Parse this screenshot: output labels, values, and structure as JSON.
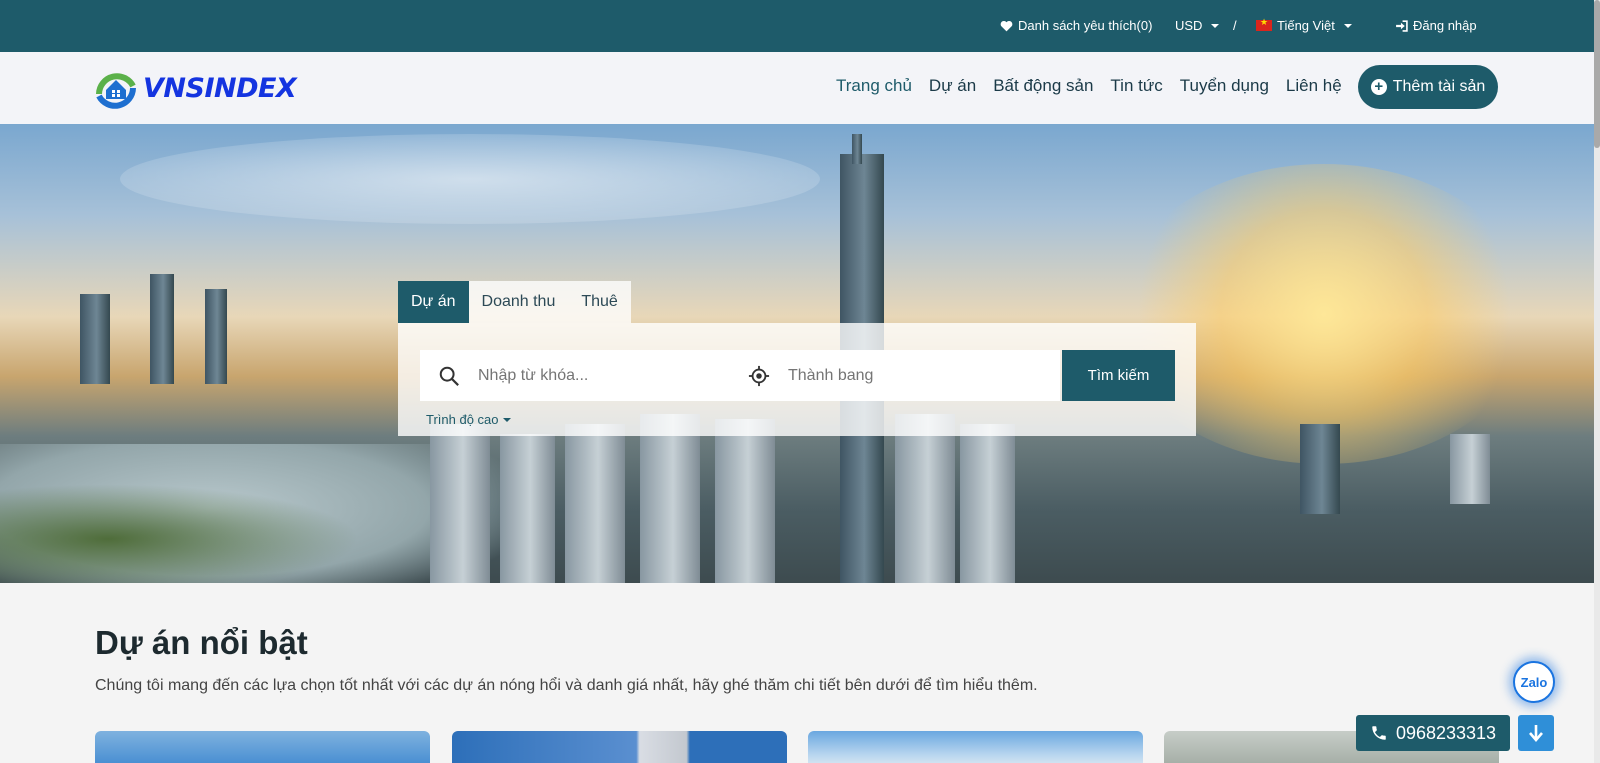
{
  "topbar": {
    "wishlist": "Danh sách yêu thích(0)",
    "currency": "USD",
    "separator": "/",
    "language": "Tiếng Việt",
    "login": "Đăng nhập"
  },
  "header": {
    "logo_text": "VNSINDEX",
    "nav": [
      "Trang chủ",
      "Dự án",
      "Bất động sản",
      "Tin tức",
      "Tuyển dụng",
      "Liên hệ"
    ],
    "add_button": "Thêm tài sản"
  },
  "search": {
    "tabs": [
      "Dự án",
      "Doanh thu",
      "Thuê"
    ],
    "keyword_placeholder": "Nhập từ khóa...",
    "location_placeholder": "Thành bang",
    "submit_label": "Tìm kiếm",
    "advanced_label": "Trình độ cao"
  },
  "featured": {
    "title": "Dự án nổi bật",
    "description": "Chúng tôi mang đến các lựa chọn tốt nhất với các dự án nóng hổi và danh giá nhất, hãy ghé thăm chi tiết bên dưới để tìm hiểu thêm."
  },
  "floating": {
    "zalo": "Zalo",
    "phone": "0968233313"
  },
  "colors": {
    "primary": "#1e5b6a",
    "logo_blue": "#1434e0",
    "zalo_blue": "#1a74e0"
  }
}
